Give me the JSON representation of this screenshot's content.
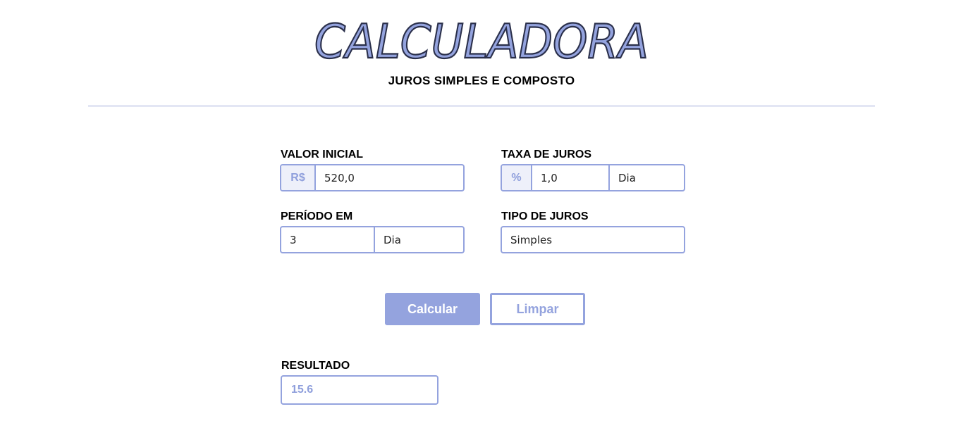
{
  "header": {
    "title": "CALCULADORA",
    "subtitle": "JUROS SIMPLES E COMPOSTO"
  },
  "form": {
    "valor_inicial": {
      "label": "VALOR INICIAL",
      "prefix": "R$",
      "value": "520,0"
    },
    "taxa_de_juros": {
      "label": "TAXA DE JUROS",
      "prefix": "%",
      "value": "1,0",
      "unit": "Dia"
    },
    "periodo": {
      "label": "PERÍODO EM",
      "value": "3",
      "unit": "Dia"
    },
    "tipo_de_juros": {
      "label": "TIPO DE JUROS",
      "value": "Simples"
    }
  },
  "actions": {
    "calcular_label": "Calcular",
    "limpar_label": "Limpar"
  },
  "result": {
    "label": "RESULTADO",
    "value": "15.6"
  },
  "colors": {
    "accent": "#94a3de",
    "accent_text": "#8f9fdc",
    "title_outline": "#2a2f4a",
    "divider": "#e3e6f4"
  }
}
